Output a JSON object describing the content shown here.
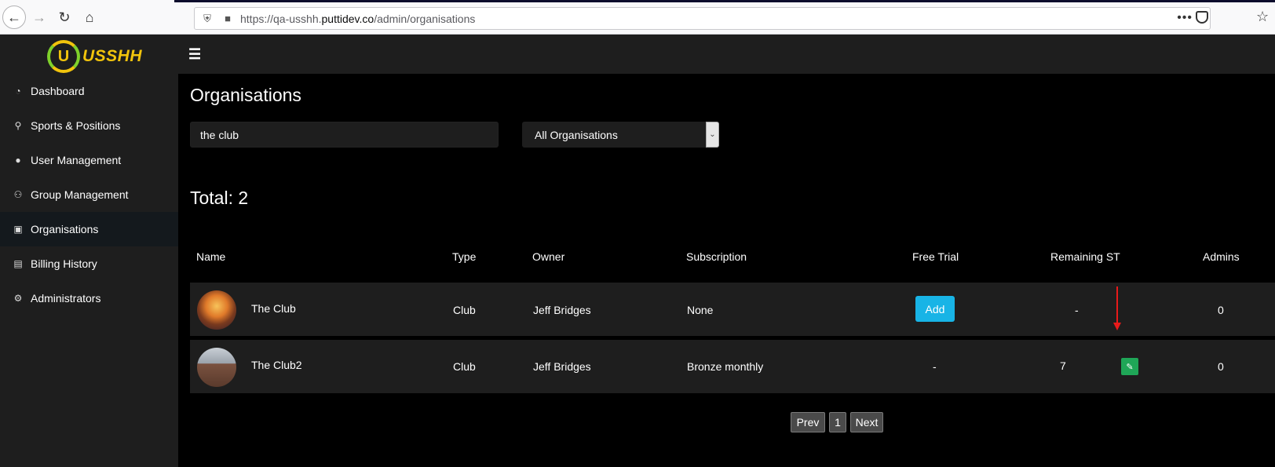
{
  "browser": {
    "url_prefix": "https://qa-usshh.",
    "url_domain": "puttidev.co",
    "url_path": "/admin/organisations",
    "page_actions": "•••"
  },
  "app": {
    "logo_letter": "U",
    "logo_text": "USSHH",
    "menu_icon": "☰"
  },
  "sidebar": {
    "items": [
      {
        "label": "Dashboard",
        "icon": "dashboard-icon",
        "glyph": "◔",
        "active": false
      },
      {
        "label": "Sports & Positions",
        "icon": "bicycle-icon",
        "glyph": "⚲",
        "active": false
      },
      {
        "label": "User Management",
        "icon": "user-icon",
        "glyph": "●",
        "active": false
      },
      {
        "label": "Group Management",
        "icon": "users-icon",
        "glyph": "⚇",
        "active": false
      },
      {
        "label": "Organisations",
        "icon": "briefcase-icon",
        "glyph": "▣",
        "active": true
      },
      {
        "label": "Billing History",
        "icon": "money-icon",
        "glyph": "▤",
        "active": false
      },
      {
        "label": "Administrators",
        "icon": "cogs-icon",
        "glyph": "⚙",
        "active": false
      }
    ]
  },
  "main": {
    "title": "Organisations",
    "search_value": "the club",
    "filter_selected": "All Organisations",
    "total_label": "Total: 2",
    "columns": [
      "Name",
      "Type",
      "Owner",
      "Subscription",
      "Free Trial",
      "Remaining ST",
      "Admins"
    ],
    "rows": [
      {
        "name": "The Club",
        "type": "Club",
        "owner": "Jeff Bridges",
        "subscription": "None",
        "free_trial": "Add",
        "remaining_st": "-",
        "admins": "0"
      },
      {
        "name": "The Club2",
        "type": "Club",
        "owner": "Jeff Bridges",
        "subscription": "Bronze monthly",
        "free_trial": "-",
        "remaining_st": "7",
        "admins": "0"
      }
    ],
    "pagination": {
      "prev": "Prev",
      "page": "1",
      "next": "Next"
    }
  },
  "colors": {
    "brand_yellow": "#f2c40c",
    "brand_green": "#7fd12b",
    "add_button": "#18b4e6",
    "edit_button": "#1fa657",
    "annotation_arrow": "#e81a1a"
  }
}
